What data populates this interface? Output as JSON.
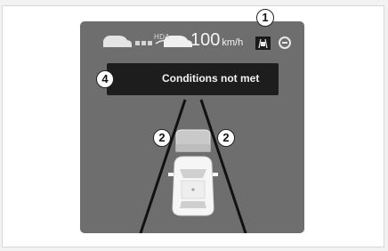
{
  "topbar": {
    "hda_label": "HDA",
    "speed_value": "100",
    "speed_unit": "km/h"
  },
  "banner": {
    "message": "Conditions not met"
  },
  "callouts": {
    "lane_keeping": "1",
    "vehicle_left": "2",
    "vehicle_right": "2",
    "message": "4"
  },
  "colors": {
    "display_bg": "#6e6e6e",
    "banner_bg": "#1d1d1d",
    "lane_lines": "#111111"
  }
}
